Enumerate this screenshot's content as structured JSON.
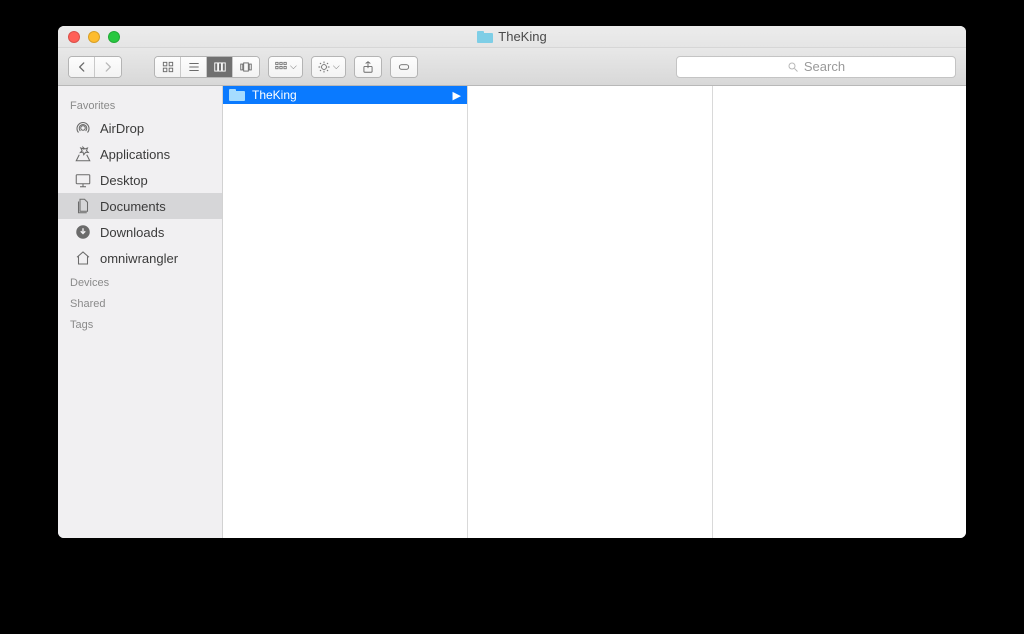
{
  "window": {
    "title": "TheKing"
  },
  "toolbar": {
    "search_placeholder": "Search"
  },
  "sidebar": {
    "sections": [
      {
        "header": "Favorites",
        "items": [
          {
            "icon": "airdrop",
            "label": "AirDrop"
          },
          {
            "icon": "applications",
            "label": "Applications"
          },
          {
            "icon": "desktop",
            "label": "Desktop"
          },
          {
            "icon": "documents",
            "label": "Documents",
            "selected": true
          },
          {
            "icon": "downloads",
            "label": "Downloads"
          },
          {
            "icon": "home",
            "label": "omniwrangler"
          }
        ]
      },
      {
        "header": "Devices",
        "items": []
      },
      {
        "header": "Shared",
        "items": []
      },
      {
        "header": "Tags",
        "items": []
      }
    ]
  },
  "columns": [
    {
      "items": [
        {
          "label": "TheKing",
          "is_folder": true,
          "selected": true,
          "has_children": true
        }
      ]
    },
    {
      "items": []
    },
    {
      "items": []
    }
  ]
}
